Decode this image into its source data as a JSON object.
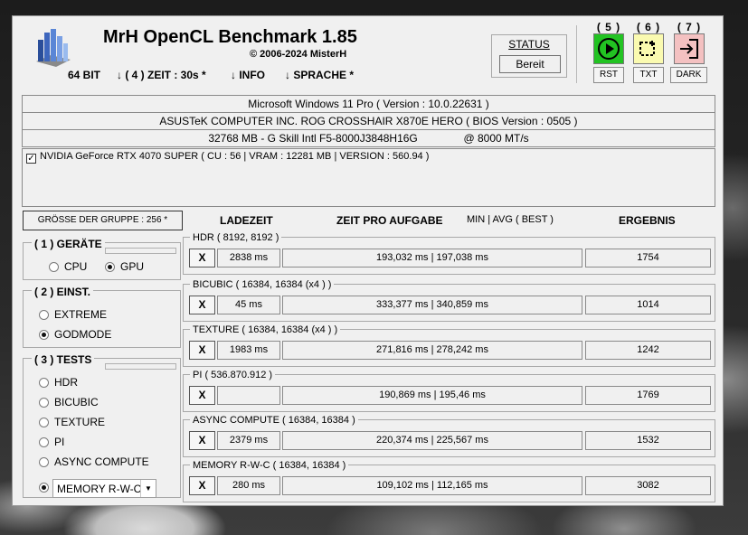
{
  "app": {
    "title": "MrH OpenCL Benchmark 1.85",
    "copyright": "© 2006-2024 MisterH"
  },
  "menu": {
    "bits": "64 BIT",
    "zeit": "↓ ( 4 ) ZEIT : 30s *",
    "info": "↓ INFO",
    "sprache": "↓ SPRACHE *"
  },
  "status": {
    "label": "STATUS",
    "value": "Bereit"
  },
  "actions": [
    {
      "number": "( 5 )",
      "label": "RST",
      "icon": "play-icon",
      "color": "#22c322"
    },
    {
      "number": "( 6 )",
      "label": "TXT",
      "icon": "selection-icon",
      "color": "#fafab0"
    },
    {
      "number": "( 7 )",
      "label": "DARK",
      "icon": "exit-icon",
      "color": "#f4c1c1"
    }
  ],
  "system": {
    "os": "Microsoft Windows 11 Pro ( Version : 10.0.22631 )",
    "board": "ASUSTeK COMPUTER INC. ROG CROSSHAIR X870E HERO ( BIOS Version : 0505 )",
    "memory": "32768 MB - G Skill Intl F5-8000J3848H16G",
    "memory_speed": "@ 8000 MT/s"
  },
  "gpu": {
    "checked": true,
    "text": "NVIDIA GeForce RTX 4070 SUPER ( CU : 56 | VRAM : 12281 MB | VERSION : 560.94 )"
  },
  "group_size": "GRÖSSE DER GRUPPE : 256 *",
  "columns": {
    "load": "LADEZEIT",
    "time_per_task": "ZEIT PRO AUFGABE",
    "min_avg": "MIN | AVG ( BEST )",
    "result": "ERGEBNIS"
  },
  "devices": {
    "legend": "( 1 ) GERÄTE",
    "options": [
      {
        "label": "CPU",
        "selected": false
      },
      {
        "label": "GPU",
        "selected": true
      }
    ]
  },
  "settings": {
    "legend": "( 2 ) EINST.",
    "options": [
      {
        "label": "EXTREME",
        "selected": false
      },
      {
        "label": "GODMODE",
        "selected": true
      }
    ]
  },
  "tests": {
    "legend": "( 3 ) TESTS",
    "options": [
      {
        "label": "HDR",
        "selected": false
      },
      {
        "label": "BICUBIC",
        "selected": false
      },
      {
        "label": "TEXTURE",
        "selected": false
      },
      {
        "label": "PI",
        "selected": false
      },
      {
        "label": "ASYNC COMPUTE",
        "selected": false
      }
    ],
    "memory_option": {
      "label": "MEMORY R-W-C",
      "selected": true
    }
  },
  "results": [
    {
      "name": "HDR ( 8192, 8192 )",
      "x": "X",
      "load": "2838 ms",
      "times": "193,032 ms | 197,038 ms",
      "result": "1754"
    },
    {
      "name": "BICUBIC ( 16384, 16384 (x4 ) )",
      "x": "X",
      "load": "45 ms",
      "times": "333,377 ms | 340,859 ms",
      "result": "1014"
    },
    {
      "name": "TEXTURE ( 16384, 16384 (x4 ) )",
      "x": "X",
      "load": "1983 ms",
      "times": "271,816 ms | 278,242 ms",
      "result": "1242"
    },
    {
      "name": "PI ( 536.870.912 )",
      "x": "X",
      "load": "",
      "times": "190,869 ms | 195,46 ms",
      "result": "1769"
    },
    {
      "name": "ASYNC COMPUTE ( 16384, 16384 )",
      "x": "X",
      "load": "2379 ms",
      "times": "220,374 ms | 225,567 ms",
      "result": "1532"
    },
    {
      "name": "MEMORY R-W-C ( 16384, 16384 )",
      "x": "X",
      "load": "280 ms",
      "times": "109,102 ms | 112,165 ms",
      "result": "3082"
    }
  ]
}
